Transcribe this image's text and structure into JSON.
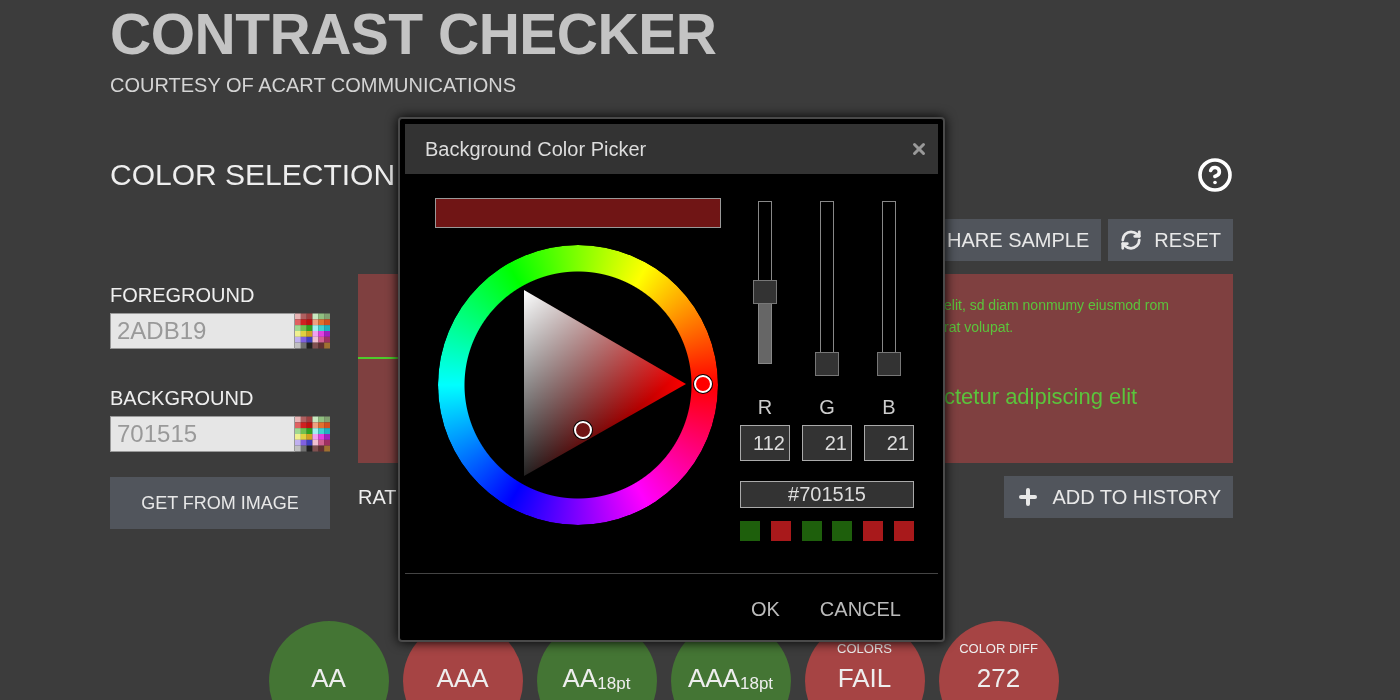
{
  "header": {
    "title": "CONTRAST CHECKER",
    "subtitle": "COURTESY OF ACART COMMUNICATIONS"
  },
  "section": {
    "title": "COLOR SELECTION"
  },
  "toolbar": [
    {
      "kind": "plain",
      "label": "HARE SAMPLE"
    },
    {
      "kind": "reset",
      "label": "RESET"
    }
  ],
  "fields": [
    {
      "label": "FOREGROUND",
      "value": "2ADB19"
    },
    {
      "label": "BACKGROUND",
      "value": "701515"
    }
  ],
  "get_image_button": "GET FROM IMAGE",
  "sample": {
    "lines": [
      {
        "kind": "small",
        "text": "elit, sd diam nonmumy eiusmod rom"
      },
      {
        "kind": "small",
        "text": "rat volupat."
      },
      {
        "kind": "large",
        "text": "ctetur adipiscing elit"
      }
    ]
  },
  "ratio_label": "RAT",
  "add_history_button": "ADD TO HISTORY",
  "results": [
    {
      "label": "AA",
      "pass": true
    },
    {
      "label": "AAA",
      "pass": false
    },
    {
      "label": "AA$_{18pt}$",
      "pass": true
    },
    {
      "label": "AAA$_{18pt}$",
      "pass": true
    },
    {
      "caption": "COLORS",
      "label": "FAIL",
      "pass": false
    },
    {
      "caption": "COLOR DIFF",
      "label": "272",
      "pass": false
    }
  ],
  "picker": {
    "title": "Background Color Picker",
    "hex": "#701515",
    "channels": [
      {
        "label": "R",
        "value": "112",
        "level": 0.44
      },
      {
        "label": "G",
        "value": "21",
        "level": 0
      },
      {
        "label": "B",
        "value": "21",
        "level": 0
      }
    ],
    "swatches": [
      {
        "color": "#1e5f0c"
      },
      {
        "color": "#a8191b"
      },
      {
        "color": "#1e5f0c"
      },
      {
        "color": "#1e5f0c"
      },
      {
        "color": "#a8191b"
      },
      {
        "color": "#a8191b"
      }
    ],
    "buttons": [
      "OK",
      "CANCEL"
    ]
  }
}
